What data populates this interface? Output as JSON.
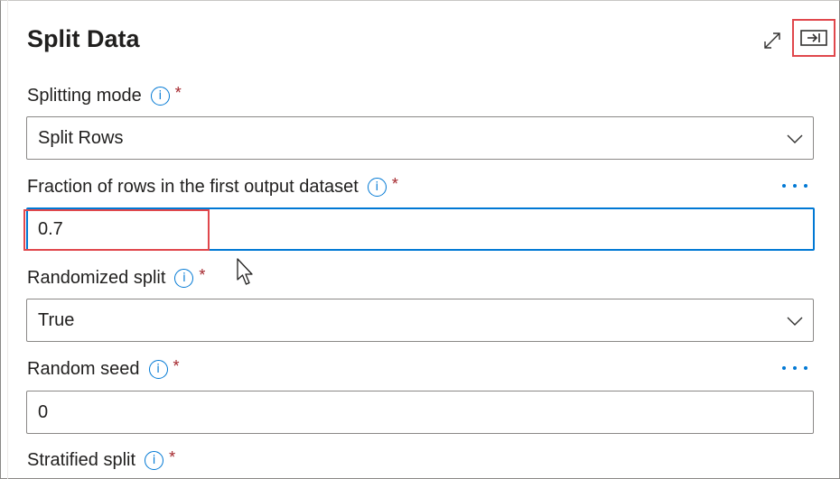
{
  "panel": {
    "title": "Split Data"
  },
  "fields": {
    "splitting_mode": {
      "label": "Splitting mode",
      "required_mark": "*",
      "value": "Split Rows"
    },
    "fraction": {
      "label": "Fraction of rows in the first output dataset",
      "required_mark": "*",
      "value": "0.7"
    },
    "randomized_split": {
      "label": "Randomized split",
      "required_mark": "*",
      "value": "True"
    },
    "random_seed": {
      "label": "Random seed",
      "required_mark": "*",
      "value": "0"
    },
    "stratified_split": {
      "label": "Stratified split",
      "required_mark": "*"
    }
  },
  "icons": {
    "info": "i"
  },
  "colors": {
    "accent": "#0078d4",
    "required": "#a4262c",
    "highlight": "#e0474c"
  }
}
